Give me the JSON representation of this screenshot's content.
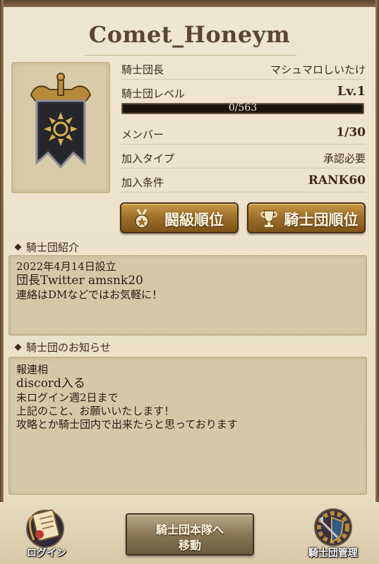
{
  "guild": {
    "name": "Comet_Honeym"
  },
  "info": {
    "leader_label": "騎士団長",
    "leader_value": "マシュマロしいたけ",
    "level_label": "騎士団レベル",
    "level_value": "Lv.1",
    "exp_text": "0/563",
    "exp_progress": 0.0,
    "members_label": "メンバー",
    "members_value": "1/30",
    "join_type_label": "加入タイプ",
    "join_type_value": "承認必要",
    "join_cond_label": "加入条件",
    "join_cond_value": "RANK60"
  },
  "buttons": {
    "battle_rank": "闘級順位",
    "guild_rank": "騎士団順位"
  },
  "intro": {
    "heading": "騎士団紹介",
    "lines": [
      "2022年4月14日設立",
      "団長Twitter amsnk20",
      "連絡はDMなどではお気軽に！"
    ]
  },
  "notice": {
    "heading": "騎士団のお知らせ",
    "lines": [
      "報連相",
      "discord入る",
      "未ログイン週2日まで",
      "上記のこと、お願いいたします！",
      "攻略とか騎士団内で出来たらと思っております"
    ]
  },
  "bottom": {
    "login_label": "ログイン",
    "move_line1": "騎士団本隊へ",
    "move_line2": "移動",
    "manage_label": "騎士団管理"
  },
  "colors": {
    "parchment": "#ece1c9",
    "panel": "#d6c7a9",
    "gold_button": "#a0702a",
    "exp_bar": "#2f8fc2"
  },
  "icons": {
    "emblem": "banner-sun-emblem-icon",
    "battle_rank": "medal-icon",
    "guild_rank": "trophy-icon",
    "login": "scroll-quill-icon",
    "manage": "gear-shield-icon"
  }
}
